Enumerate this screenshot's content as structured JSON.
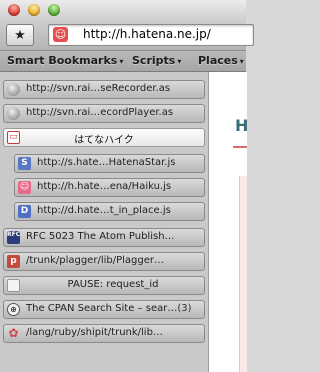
{
  "toolbar": {
    "bookmark_button_icon": "star-icon",
    "url": "http://h.hatena.ne.jp/"
  },
  "bookmarks_bar": {
    "items": [
      {
        "label": "Smart Bookmarks"
      },
      {
        "label": "Scripts"
      },
      {
        "label": "Places"
      }
    ],
    "arrow": "▾"
  },
  "sidebar": {
    "rows": [
      {
        "label": "http://svn.rai…seRecorder.as",
        "icon": "globe-icon"
      },
      {
        "label": "http://svn.rai…ecordPlayer.as",
        "icon": "globe-icon"
      },
      {
        "label": "はてなハイク",
        "icon": "folder-icon"
      },
      {
        "label": "http://s.hate…HatenaStar.js",
        "icon": "hatena-star-icon"
      },
      {
        "label": "http://h.hate…ena/Haiku.js",
        "icon": "haiku-icon"
      },
      {
        "label": "http://d.hate…t_in_place.js",
        "icon": "hatena-diary-icon"
      },
      {
        "label": "RFC 5023 The Atom Publish…",
        "icon": "rfc-icon"
      },
      {
        "label": "/trunk/plagger/lib/Plagger…",
        "icon": "plagger-icon"
      },
      {
        "label": "PAUSE: request_id",
        "icon": "pause-icon"
      },
      {
        "label": "The CPAN Search Site – sear…",
        "count": "(3)",
        "icon": "cpan-icon"
      },
      {
        "label": "/lang/ruby/shipit/trunk/lib…",
        "icon": "flower-icon"
      }
    ]
  },
  "page": {
    "heading_fragment": "H"
  }
}
